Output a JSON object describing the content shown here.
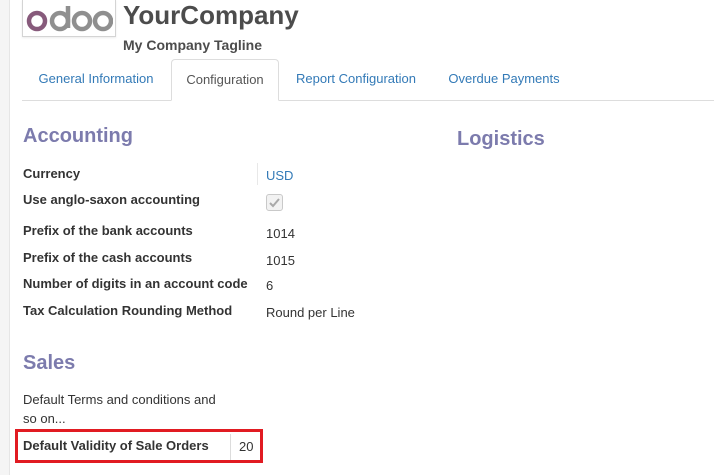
{
  "header": {
    "logo_text": "odoo",
    "company_name": "YourCompany",
    "tagline": "My Company Tagline"
  },
  "tabs": [
    {
      "label": "General Information",
      "active": false
    },
    {
      "label": "Configuration",
      "active": true
    },
    {
      "label": "Report Configuration",
      "active": false
    },
    {
      "label": "Overdue Payments",
      "active": false
    }
  ],
  "accounting": {
    "title": "Accounting",
    "fields": [
      {
        "label": "Currency",
        "value": "USD"
      },
      {
        "label": "Use anglo-saxon accounting",
        "checked": true
      },
      {
        "label": "Prefix of the bank accounts",
        "value": "1014"
      },
      {
        "label": "Prefix of the cash accounts",
        "value": "1015"
      },
      {
        "label": "Number of digits in an account code",
        "value": "6"
      },
      {
        "label": "Tax Calculation Rounding Method",
        "value": "Round per Line"
      }
    ]
  },
  "logistics": {
    "title": "Logistics"
  },
  "sales": {
    "title": "Sales",
    "terms_placeholder": "Default Terms and conditions and so on...",
    "validity_label": "Default Validity of Sale Orders",
    "validity_value": "20"
  },
  "colors": {
    "section_title": "#7c7bad",
    "link": "#337ab7",
    "highlight": "#e11b22",
    "logo": "#875a7b"
  }
}
